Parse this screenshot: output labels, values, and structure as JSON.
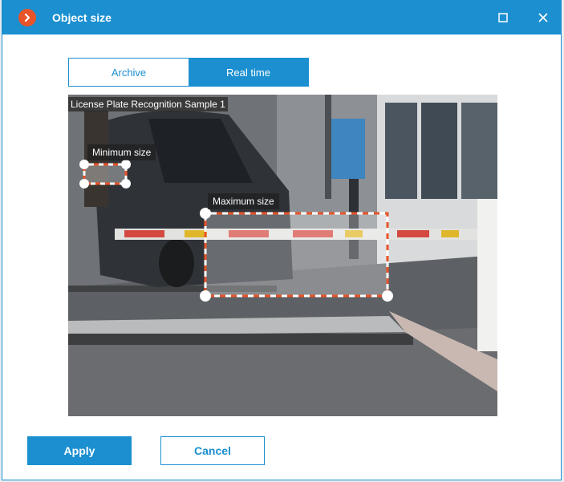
{
  "window": {
    "title": "Object size",
    "maximize_icon": "maximize-icon",
    "close_icon": "close-icon",
    "accent": "#1b8fd0",
    "logo_color": "#e8542a"
  },
  "tabs": [
    {
      "label": "Archive",
      "active": false
    },
    {
      "label": "Real time",
      "active": true
    }
  ],
  "video": {
    "camera_label": "License Plate Recognition Sample 1",
    "min_size_label": "Minimum size",
    "max_size_label": "Maximum size",
    "marker_color": "#e8542a"
  },
  "buttons": {
    "apply": "Apply",
    "cancel": "Cancel"
  }
}
